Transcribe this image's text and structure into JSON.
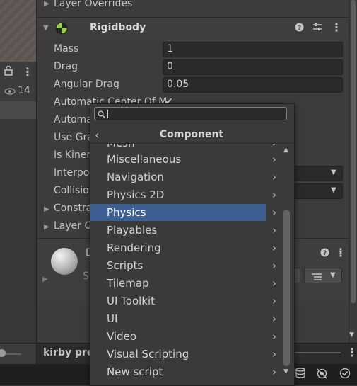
{
  "left_panel": {
    "eye_count": "14"
  },
  "inspector": {
    "layer_overrides_top": "Layer Overrides",
    "component_title": "Rigidbody",
    "fields": [
      {
        "label": "Mass",
        "value": "1"
      },
      {
        "label": "Drag",
        "value": "0"
      },
      {
        "label": "Angular Drag",
        "value": "0.05"
      }
    ],
    "partial_labels": {
      "auto_center": "Automatic Center Of M",
      "auto_tensor": "Automa",
      "use_gravity": "Use Gra",
      "is_kinematic": "Is Kiner",
      "interpolate": "Interpo",
      "collision": "Collisio",
      "constraints": "Constra",
      "layer_overrides": "Layer C"
    },
    "material_letter_d": "D",
    "material_letter_s": "S"
  },
  "project_bar": {
    "label": "kirby pre"
  },
  "popup": {
    "search_placeholder": "",
    "title": "Component",
    "partial_top_item": "Mesh",
    "items": [
      {
        "label": "Miscellaneous"
      },
      {
        "label": "Navigation"
      },
      {
        "label": "Physics 2D"
      },
      {
        "label": "Physics"
      },
      {
        "label": "Playables"
      },
      {
        "label": "Rendering"
      },
      {
        "label": "Scripts"
      },
      {
        "label": "Tilemap"
      },
      {
        "label": "UI Toolkit"
      },
      {
        "label": "UI"
      },
      {
        "label": "Video"
      },
      {
        "label": "Visual Scripting"
      },
      {
        "label": "New script"
      }
    ],
    "selected_index": 3
  },
  "colors": {
    "selection": "#3d5f91",
    "search_focus": "#3d8fd8"
  }
}
